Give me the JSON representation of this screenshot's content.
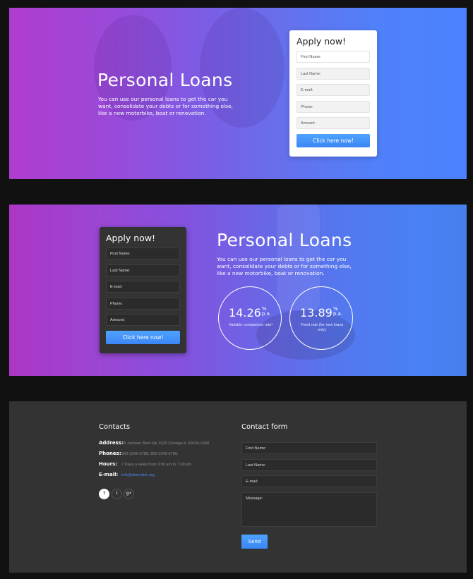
{
  "colors": {
    "page_background": "#111111",
    "gradient_start": "#b03ccf",
    "gradient_end": "#4b82fe",
    "button_blue": "#3f8ef8",
    "footer_background": "#333333",
    "link_blue": "#4f83ee"
  },
  "hero1": {
    "title": "Personal Loans",
    "description": "You can use our personal loans to get the car you want, consolidate your debts or for something else, like a new motorbike, boat or renovation.",
    "apply_form": {
      "title": "Apply now!",
      "fields": [
        {
          "placeholder": "First Name:"
        },
        {
          "placeholder": "Last Name:"
        },
        {
          "placeholder": "E-mail:"
        },
        {
          "placeholder": "Phone:"
        },
        {
          "placeholder": "Amount:"
        }
      ],
      "submit_label": "Click here now!"
    }
  },
  "hero2": {
    "title": "Personal Loans",
    "description": "You can use our personal loans to get the car you want, consolidate your debts or for something else, like a new motorbike, boat or renovation.",
    "apply_form": {
      "title": "Apply now!",
      "fields": [
        {
          "placeholder": "First Name:"
        },
        {
          "placeholder": "Last Name:"
        },
        {
          "placeholder": "E-mail:"
        },
        {
          "placeholder": "Phone:"
        },
        {
          "placeholder": "Amount:"
        }
      ],
      "submit_label": "Click here now!"
    },
    "rates": [
      {
        "value": "14.26",
        "unit_top": "%",
        "unit_bottom": "p.a.",
        "label": "Variable comparison rate¹"
      },
      {
        "value": "13.89",
        "unit_top": "%",
        "unit_bottom": "p.a.",
        "label": "Fixed rate (for new loans only)"
      }
    ]
  },
  "footer": {
    "contacts": {
      "title": "Contacts",
      "rows": [
        {
          "label": "Address:",
          "value": "28 Jackson Blvd Ste 1020 Chicago IL 60604-2340"
        },
        {
          "label": "Phones:",
          "value": "800-2345-6789;  800-2345-6790;"
        },
        {
          "label": "Hours:",
          "value": "7 Days a week from 9:00 am to 7:00 pm"
        },
        {
          "label": "E-mail:",
          "value": "info@demolink.org"
        }
      ],
      "social": [
        {
          "icon": "facebook-icon",
          "glyph": "f"
        },
        {
          "icon": "twitter-icon",
          "glyph": "t"
        },
        {
          "icon": "google-plus-icon",
          "glyph": "g+"
        }
      ]
    },
    "contact_form": {
      "title": "Contact form",
      "fields": [
        {
          "placeholder": "First Name:"
        },
        {
          "placeholder": "Last Name:"
        },
        {
          "placeholder": "E-mail:"
        },
        {
          "placeholder": "Message:"
        }
      ],
      "submit_label": "Send"
    }
  }
}
